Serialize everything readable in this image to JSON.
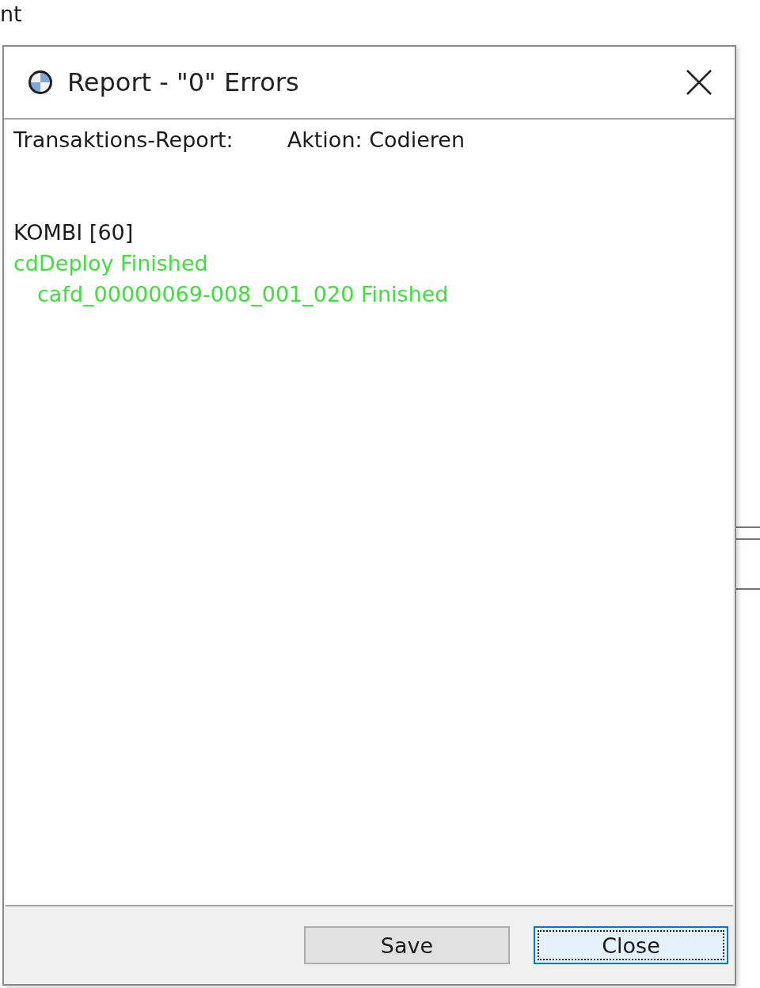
{
  "background": {
    "label": "nt"
  },
  "window": {
    "title": "Report - \"0\" Errors"
  },
  "report": {
    "label": "Transaktions-Report:",
    "action": "Aktion: Codieren",
    "lines": [
      {
        "text": "KOMBI [60]",
        "kind": "unit"
      },
      {
        "text": "cdDeploy Finished",
        "kind": "success",
        "children": [
          {
            "text": "cafd_00000069-008_001_020 Finished",
            "kind": "success"
          }
        ]
      }
    ]
  },
  "buttons": [
    {
      "label": "Save",
      "focused": false
    },
    {
      "label": "Close",
      "focused": true
    }
  ]
}
